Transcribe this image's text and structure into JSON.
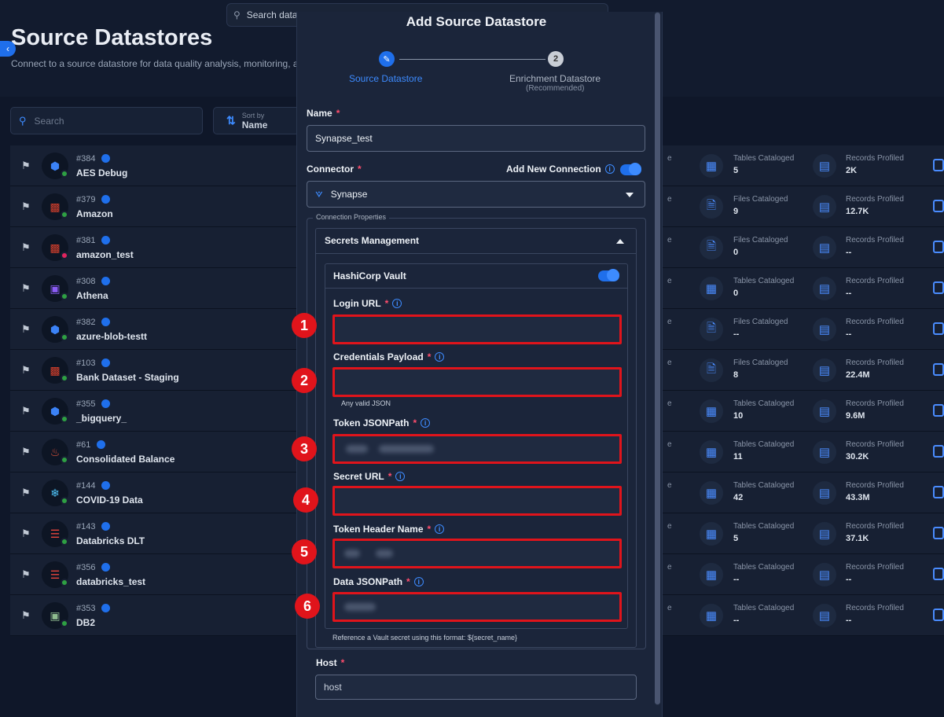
{
  "top_search": {
    "placeholder": "Search data"
  },
  "page": {
    "title": "Source Datastores",
    "subtitle": "Connect to a source datastore for data quality analysis, monitoring, a"
  },
  "list_search": {
    "placeholder": "Search"
  },
  "sort": {
    "small": "Sort by",
    "value": "Name"
  },
  "stat_partial": "e",
  "rows": [
    {
      "id": "#384",
      "name": "AES Debug",
      "status": "green",
      "logo": "bigquery-icon",
      "stat1_label": "Tables Cataloged",
      "stat1_value": "5",
      "stat2_label": "Records Profiled",
      "stat2_value": "2K"
    },
    {
      "id": "#379",
      "name": "Amazon",
      "status": "green",
      "logo": "s3-icon",
      "stat1_label": "Files Cataloged",
      "stat1_value": "9",
      "stat2_label": "Records Profiled",
      "stat2_value": "12.7K"
    },
    {
      "id": "#381",
      "name": "amazon_test",
      "status": "red",
      "logo": "s3-icon",
      "stat1_label": "Files Cataloged",
      "stat1_value": "0",
      "stat2_label": "Records Profiled",
      "stat2_value": "--"
    },
    {
      "id": "#308",
      "name": "Athena",
      "status": "green",
      "logo": "athena-icon",
      "stat1_label": "Tables Cataloged",
      "stat1_value": "0",
      "stat2_label": "Records Profiled",
      "stat2_value": "--"
    },
    {
      "id": "#382",
      "name": "azure-blob-testt",
      "status": "green",
      "logo": "azure-icon",
      "stat1_label": "Files Cataloged",
      "stat1_value": "--",
      "stat2_label": "Records Profiled",
      "stat2_value": "--"
    },
    {
      "id": "#103",
      "name": "Bank Dataset - Staging",
      "status": "green",
      "logo": "s3-icon",
      "stat1_label": "Files Cataloged",
      "stat1_value": "8",
      "stat2_label": "Records Profiled",
      "stat2_value": "22.4M"
    },
    {
      "id": "#355",
      "name": "_bigquery_",
      "status": "green",
      "logo": "bigquery-icon",
      "stat1_label": "Tables Cataloged",
      "stat1_value": "10",
      "stat2_label": "Records Profiled",
      "stat2_value": "9.6M"
    },
    {
      "id": "#61",
      "name": "Consolidated Balance",
      "status": "green",
      "logo": "java-icon",
      "stat1_label": "Tables Cataloged",
      "stat1_value": "11",
      "stat2_label": "Records Profiled",
      "stat2_value": "30.2K"
    },
    {
      "id": "#144",
      "name": "COVID-19 Data",
      "status": "green",
      "logo": "snowflake-icon",
      "stat1_label": "Tables Cataloged",
      "stat1_value": "42",
      "stat2_label": "Records Profiled",
      "stat2_value": "43.3M"
    },
    {
      "id": "#143",
      "name": "Databricks DLT",
      "status": "green",
      "logo": "databricks-icon",
      "stat1_label": "Tables Cataloged",
      "stat1_value": "5",
      "stat2_label": "Records Profiled",
      "stat2_value": "37.1K"
    },
    {
      "id": "#356",
      "name": "databricks_test",
      "status": "green",
      "logo": "databricks-icon",
      "stat1_label": "Tables Cataloged",
      "stat1_value": "--",
      "stat2_label": "Records Profiled",
      "stat2_value": "--"
    },
    {
      "id": "#353",
      "name": "DB2",
      "status": "green",
      "logo": "ibm-db2-icon",
      "stat1_label": "Tables Cataloged",
      "stat1_value": "--",
      "stat2_label": "Records Profiled",
      "stat2_value": "--"
    }
  ],
  "modal": {
    "title": "Add Source Datastore",
    "step1": {
      "label": "Source Datastore"
    },
    "step2": {
      "number": "2",
      "label": "Enrichment Datastore",
      "sub": "(Recommended)"
    },
    "name_label": "Name",
    "name_value": "Synapse_test",
    "connector_label": "Connector",
    "add_connection_label": "Add New Connection",
    "connector_value": "Synapse",
    "connection_properties": "Connection Properties",
    "secrets_management": "Secrets Management",
    "hashicorp_vault": "HashiCorp Vault",
    "login_url_label": "Login URL",
    "credentials_payload_label": "Credentials Payload",
    "credentials_helper": "Any valid JSON",
    "token_jsonpath_label": "Token JSONPath",
    "secret_url_label": "Secret URL",
    "token_header_label": "Token Header Name",
    "data_jsonpath_label": "Data JSONPath",
    "vault_helper": "Reference a Vault secret using this format: ${secret_name}",
    "host_label": "Host",
    "host_placeholder": "host"
  },
  "callouts": [
    "1",
    "2",
    "3",
    "4",
    "5",
    "6"
  ],
  "colors": {
    "accent": "#1f6feb",
    "highlight": "#e0141b",
    "required": "#ff4d6d",
    "status_green": "#2ea043",
    "status_red": "#e0245e"
  }
}
